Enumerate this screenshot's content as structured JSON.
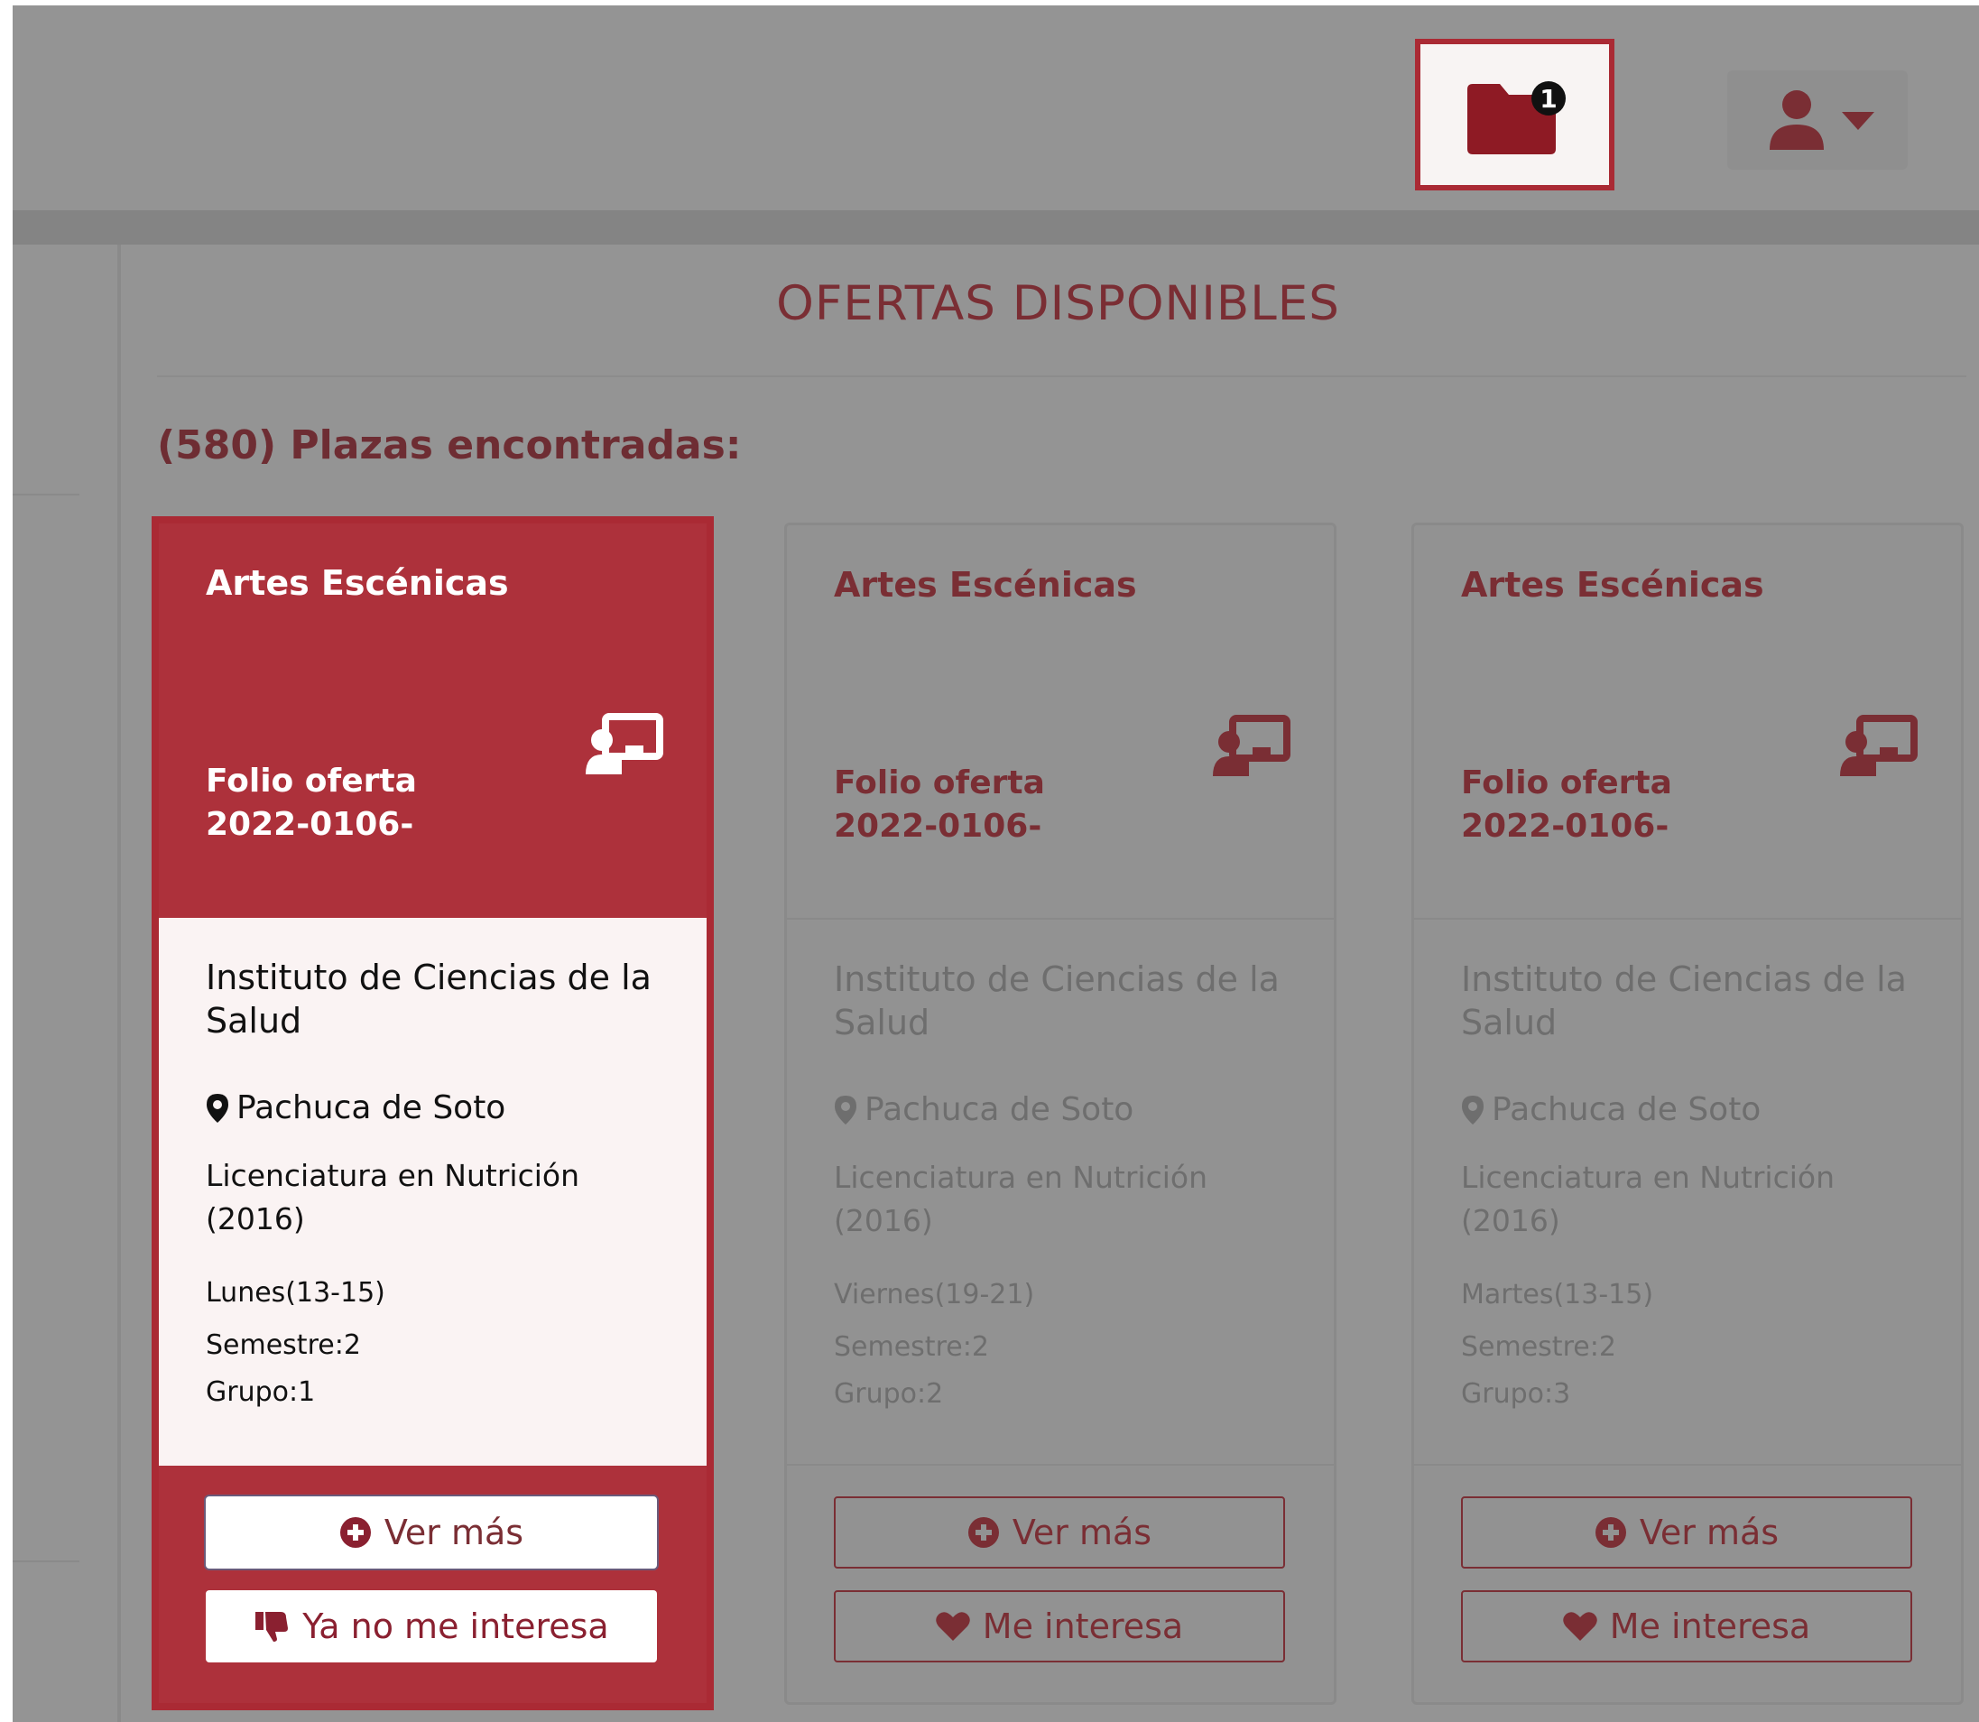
{
  "header": {
    "notification_count": "1"
  },
  "main": {
    "title": "OFERTAS DISPONIBLES",
    "count_label": "(580) Plazas encontradas:"
  },
  "cards": [
    {
      "category": "Artes Escénicas",
      "folio_label": "Folio oferta",
      "folio_number": "2022-0106-",
      "institution": "Instituto de Ciencias de la Salud",
      "location": "Pachuca de Soto",
      "degree": "Licenciatura en Nutrición (2016)",
      "schedule": "Lunes(13-15)",
      "semester": "Semestre:2",
      "group": "Grupo:1",
      "more_label": "Ver más",
      "action_label": "Ya no me interesa"
    },
    {
      "category": "Artes Escénicas",
      "folio_label": "Folio oferta",
      "folio_number": "2022-0106-",
      "institution": "Instituto de Ciencias de la Salud",
      "location": "Pachuca de Soto",
      "degree": "Licenciatura en Nutrición (2016)",
      "schedule": "Viernes(19-21)",
      "semester": "Semestre:2",
      "group": "Grupo:2",
      "more_label": "Ver más",
      "action_label": "Me interesa"
    },
    {
      "category": "Artes Escénicas",
      "folio_label": "Folio oferta",
      "folio_number": "2022-0106-",
      "institution": "Instituto de Ciencias de la Salud",
      "location": "Pachuca de Soto",
      "degree": "Licenciatura en Nutrición (2016)",
      "schedule": "Martes(13-15)",
      "semester": "Semestre:2",
      "group": "Grupo:3",
      "more_label": "Ver más",
      "action_label": "Me interesa"
    }
  ],
  "colors": {
    "brand": "#ad313b",
    "text_brand": "#7a2e34",
    "overlay": "#949494"
  },
  "icons": {
    "folder": "folder-icon",
    "user": "user-icon",
    "caret": "caret-down-icon",
    "teacher": "chalkboard-teacher-icon",
    "location": "map-marker-icon",
    "plus": "plus-circle-icon",
    "thumbs_down": "thumbs-down-icon",
    "heart": "heart-icon"
  }
}
